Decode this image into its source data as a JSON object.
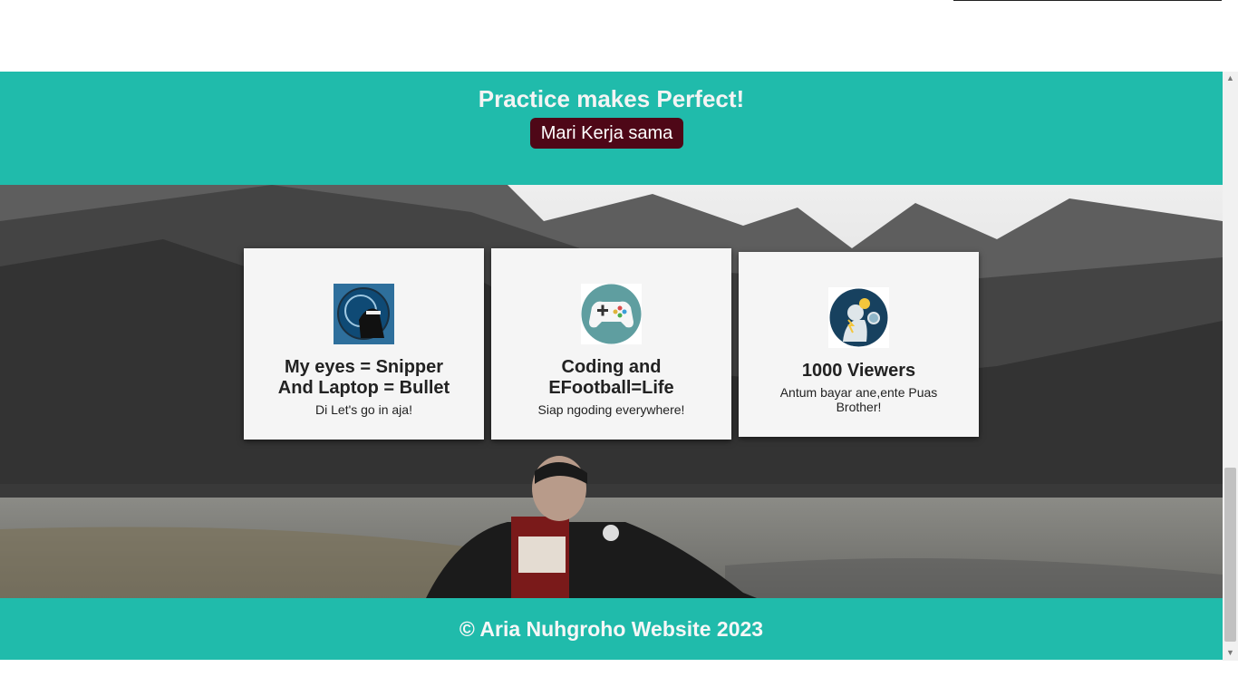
{
  "hero": {
    "title": "Practice makes Perfect!",
    "cta_label": "Mari Kerja sama"
  },
  "cards": [
    {
      "title_line1": "My eyes = Snipper",
      "title_line2": "And Laptop = Bullet",
      "text": "Di Let's go in aja!",
      "icon": "sniper-ninja-icon"
    },
    {
      "title_line1": "Coding and",
      "title_line2": "EFootball=Life",
      "text": "Siap ngoding everywhere!",
      "icon": "gamepad-icon"
    },
    {
      "title_line1": "1000 Viewers",
      "text_line1": "Antum bayar ane,ente Puas",
      "text_line2": "Brother!",
      "icon": "thinking-person-icon"
    }
  ],
  "footer": {
    "text": "© Aria Nuhgroho Website 2023"
  },
  "colors": {
    "teal": "#20bbab",
    "button": "#4e0717",
    "card": "#f5f5f5"
  },
  "scrollbar": {
    "up": "▲",
    "down": "▼"
  }
}
